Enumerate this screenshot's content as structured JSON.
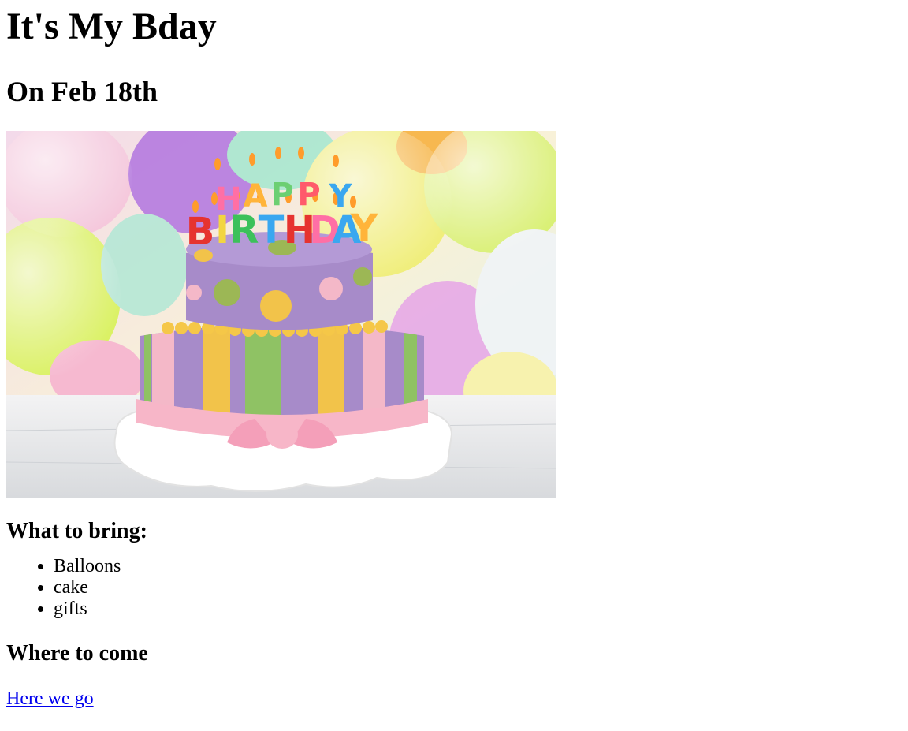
{
  "heading": "It's My Bday",
  "subheading": "On Feb 18th",
  "image": {
    "candle_letters_top": [
      "H",
      "A",
      "P",
      "P",
      "Y"
    ],
    "candle_letters_bottom": [
      "B",
      "I",
      "R",
      "T",
      "H",
      "D",
      "A",
      "Y"
    ],
    "colors": {
      "tier_purple": "#a78bc9",
      "stripe_yellow": "#f2c34a",
      "stripe_green": "#8fc264",
      "stripe_pink": "#f4b8c8",
      "ribbon_pink": "#f7b6c8",
      "plate": "#ffffff"
    }
  },
  "bring": {
    "title": "What to bring:",
    "items": [
      "Balloons",
      "cake",
      "gifts"
    ]
  },
  "where": {
    "title": "Where to come",
    "link_text": "Here we go"
  }
}
